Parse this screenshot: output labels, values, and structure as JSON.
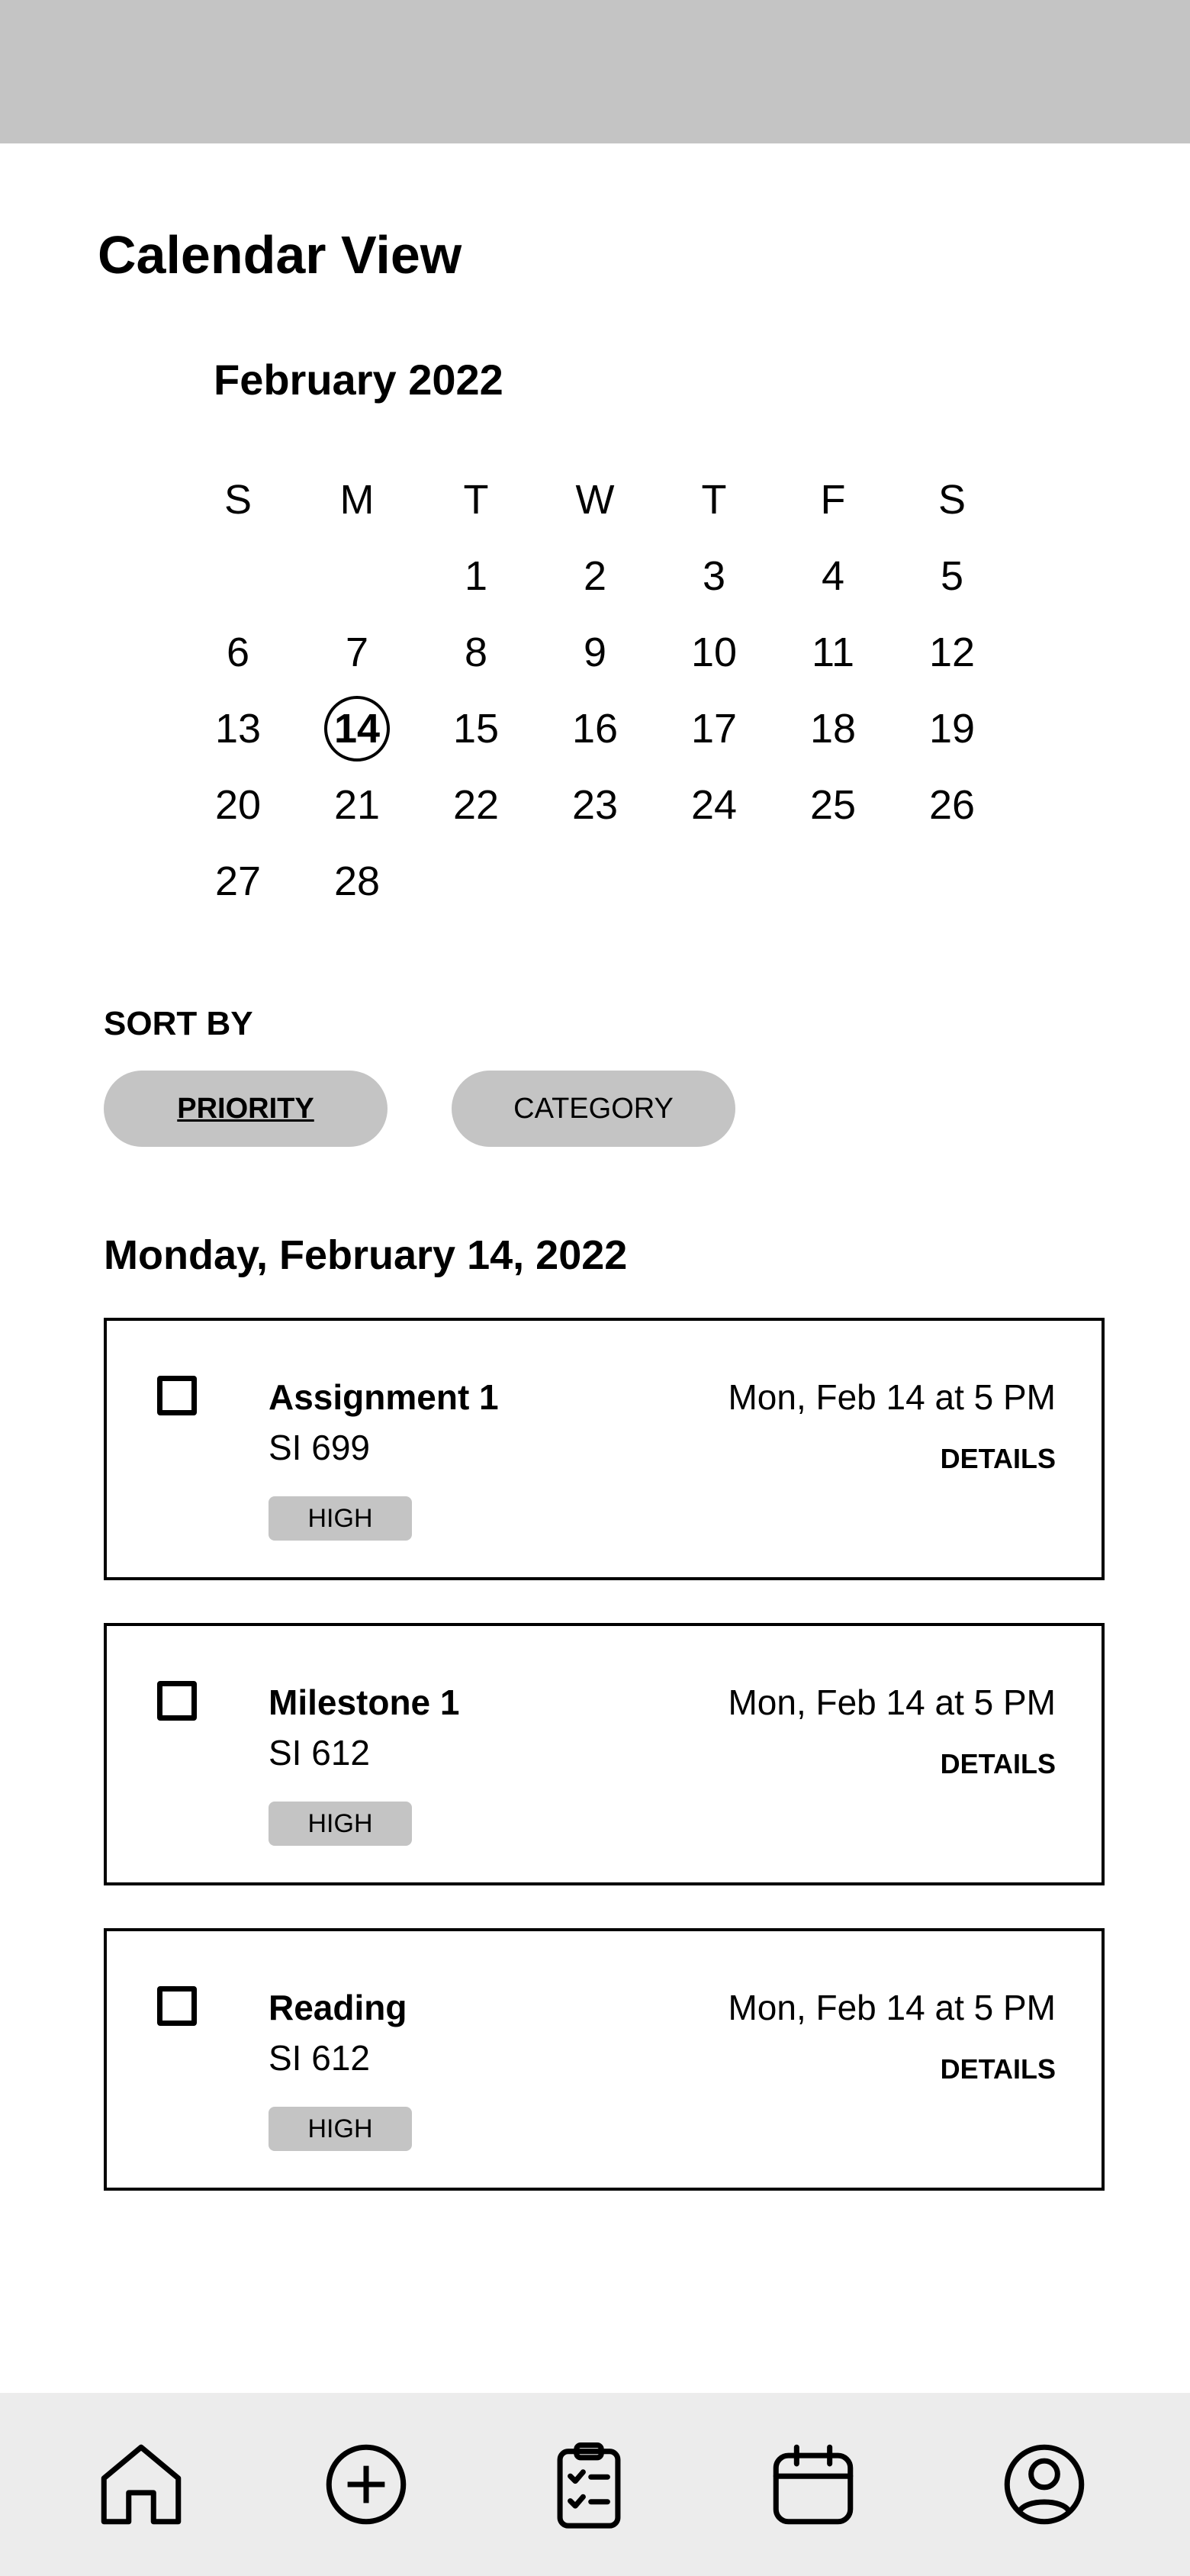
{
  "page": {
    "title": "Calendar View"
  },
  "calendar": {
    "month": "February 2022",
    "weekdays": [
      "S",
      "M",
      "T",
      "W",
      "T",
      "F",
      "S"
    ],
    "weeks": [
      [
        "",
        "",
        "1",
        "2",
        "3",
        "4",
        "5"
      ],
      [
        "6",
        "7",
        "8",
        "9",
        "10",
        "11",
        "12"
      ],
      [
        "13",
        "14",
        "15",
        "16",
        "17",
        "18",
        "19"
      ],
      [
        "20",
        "21",
        "22",
        "23",
        "24",
        "25",
        "26"
      ],
      [
        "27",
        "28",
        "",
        "",
        "",
        "",
        ""
      ]
    ],
    "selected_day": "14"
  },
  "sort": {
    "label": "SORT BY",
    "options": [
      "PRIORITY",
      "CATEGORY"
    ],
    "active": "PRIORITY"
  },
  "day_heading": "Monday, February 14, 2022",
  "tasks": [
    {
      "title": "Assignment 1",
      "course": "SI 699",
      "priority": "HIGH",
      "due": "Mon, Feb 14 at 5 PM",
      "details_label": "DETAILS",
      "checked": false
    },
    {
      "title": "Milestone 1",
      "course": "SI 612",
      "priority": "HIGH",
      "due": "Mon, Feb 14 at 5 PM",
      "details_label": "DETAILS",
      "checked": false
    },
    {
      "title": "Reading",
      "course": "SI 612",
      "priority": "HIGH",
      "due": "Mon, Feb 14 at 5 PM",
      "details_label": "DETAILS",
      "checked": false
    }
  ],
  "nav": {
    "icons": [
      "home-icon",
      "add-circle-icon",
      "clipboard-checklist-icon",
      "calendar-icon",
      "user-profile-icon"
    ]
  },
  "colors": {
    "status_bar": "#c4c4c4",
    "pill": "#c4c4c4",
    "nav_bg": "#ececec",
    "text": "#000000"
  }
}
